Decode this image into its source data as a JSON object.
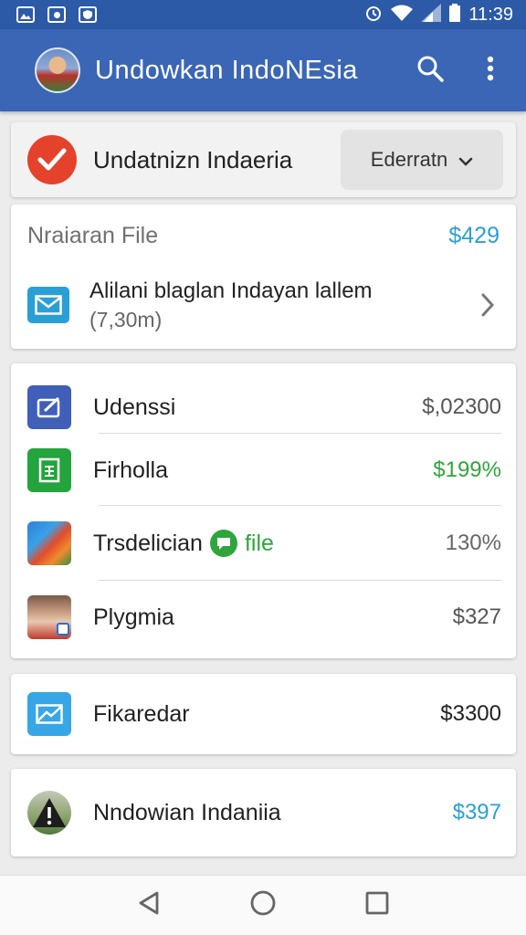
{
  "status_bar": {
    "time": "11:39"
  },
  "app_bar": {
    "title": "Undowkan IndoNEsia"
  },
  "header": {
    "title": "Undatnizn Indaeria",
    "dropdown_value": "Ederratn"
  },
  "file_card": {
    "heading": "Nraiaran File",
    "amount": "$429",
    "item_title": "Alilani blaglan Indayan lallem",
    "item_subtitle": "(7,30m)"
  },
  "list": {
    "items": [
      {
        "label": "Udenssi",
        "value": "$,02300",
        "value_color": "#555555"
      },
      {
        "label": "Firholla",
        "value": "$199%",
        "value_color": "#2fa63b"
      },
      {
        "label": "Trsdelician",
        "tag": "file",
        "value": "130%",
        "value_color": "#666666"
      },
      {
        "label": "Plygmia",
        "value": "$327",
        "value_color": "#555555"
      }
    ]
  },
  "card_a": {
    "label": "Fikaredar",
    "value": "$3300"
  },
  "card_b": {
    "label": "Nndowian Indaniia",
    "value": "$397"
  },
  "colors": {
    "app_bar": "#3a66b5",
    "status_bar": "#2c5aa7",
    "accent_blue": "#2a9fd6",
    "accent_green": "#2fa63b",
    "check_red": "#e5422b"
  },
  "icons": {
    "app_bar": [
      "avatar",
      "search-icon",
      "more-vert-icon"
    ],
    "header": "check-icon",
    "file_item": "mail-icon",
    "list": [
      "edit-box-icon",
      "spreadsheet-icon",
      "map-icon",
      "photo-icon"
    ],
    "card_a": "mail-icon",
    "card_b": "warning-icon",
    "nav": [
      "back-icon",
      "home-icon",
      "recents-icon"
    ]
  }
}
